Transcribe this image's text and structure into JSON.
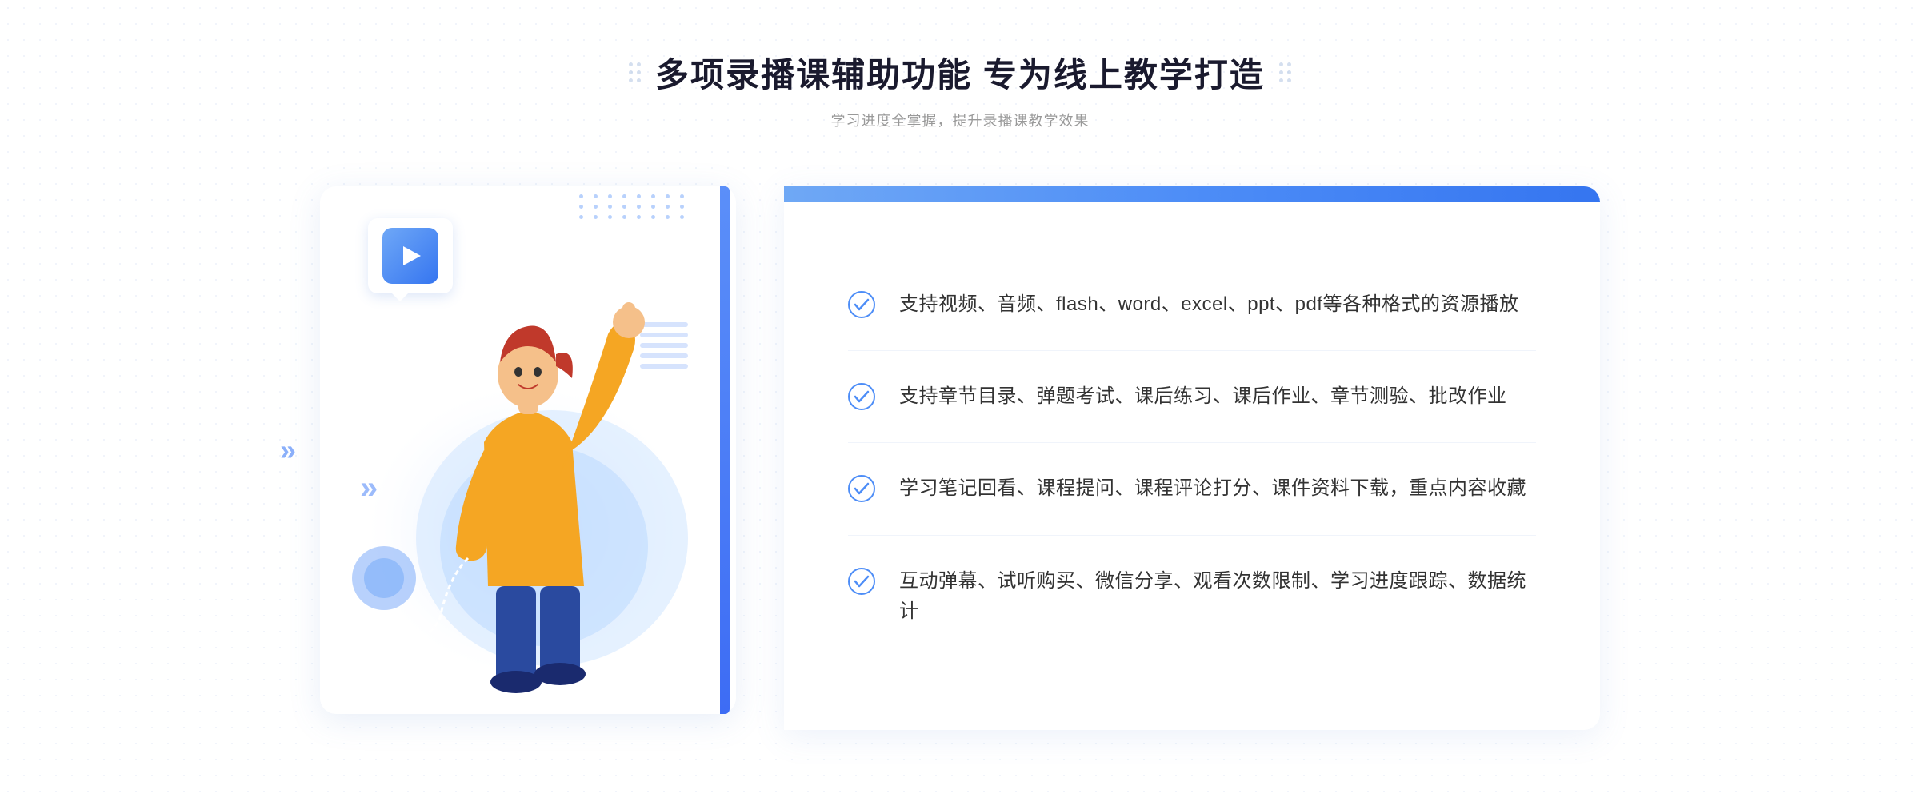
{
  "header": {
    "title": "多项录播课辅助功能 专为线上教学打造",
    "subtitle": "学习进度全掌握，提升录播课教学效果"
  },
  "features": [
    {
      "id": "feature-1",
      "text": "支持视频、音频、flash、word、excel、ppt、pdf等各种格式的资源播放"
    },
    {
      "id": "feature-2",
      "text": "支持章节目录、弹题考试、课后练习、课后作业、章节测验、批改作业"
    },
    {
      "id": "feature-3",
      "text": "学习笔记回看、课程提问、课程评论打分、课件资料下载，重点内容收藏"
    },
    {
      "id": "feature-4",
      "text": "互动弹幕、试听购买、微信分享、观看次数限制、学习进度跟踪、数据统计"
    }
  ],
  "colors": {
    "primary": "#3575f0",
    "primary_light": "#6fa8f7",
    "check_color": "#4d8df7"
  }
}
